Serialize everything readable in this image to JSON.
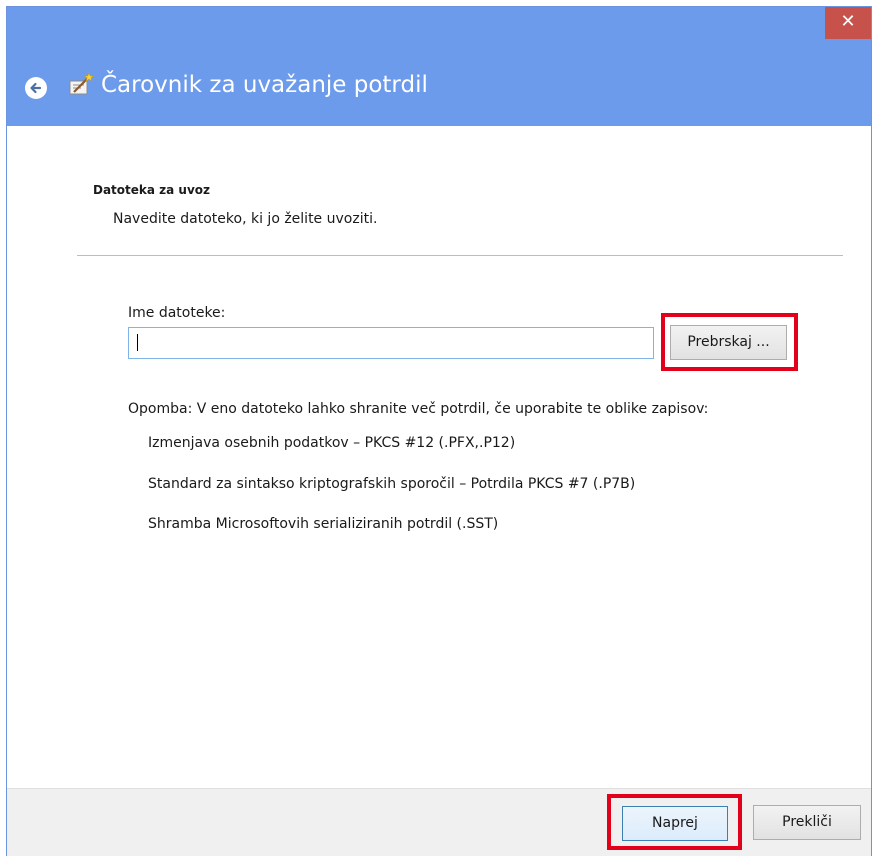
{
  "window": {
    "title": "Čarovnik za uvažanje potrdil",
    "close_glyph": "✕",
    "icons": {
      "back": "back-arrow-icon",
      "wizard": "certificate-wizard-icon",
      "close": "close-icon"
    }
  },
  "page": {
    "heading": "Datoteka za uvoz",
    "subheading": "Navedite datoteko, ki jo želite uvoziti."
  },
  "file": {
    "label": "Ime datoteke:",
    "value": "",
    "browse_label": "Prebrskaj ..."
  },
  "note": {
    "text": "Opomba: V eno datoteko lahko shranite več potrdil, če uporabite te oblike zapisov:",
    "formats": [
      "Izmenjava osebnih podatkov – PKCS #12 (.PFX,.P12)",
      "Standard za sintakso kriptografskih sporočil – Potrdila PKCS #7 (.P7B)",
      "Shramba Microsoftovih serializiranih potrdil (.SST)"
    ]
  },
  "footer": {
    "next_label": "Naprej",
    "cancel_label": "Prekliči"
  },
  "colors": {
    "titlebar": "#6d9bec",
    "close": "#c7524c",
    "highlight": "#e2001a"
  }
}
